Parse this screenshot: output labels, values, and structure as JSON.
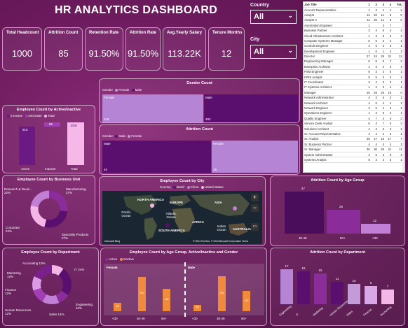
{
  "title": "HR ANALYTICS DASHBOARD",
  "kpis": [
    {
      "label": "Total Headcount",
      "value": "1000"
    },
    {
      "label": "Attrition Count",
      "value": "85"
    },
    {
      "label": "Retention Rate",
      "value": "91.50%"
    },
    {
      "label": "Attrition Rate",
      "value": "91.50%"
    },
    {
      "label": "Avg.Yearly Salary",
      "value": "113.22K"
    },
    {
      "label": "Tenure Months",
      "value": "12"
    }
  ],
  "slicers": {
    "country": {
      "label": "Country",
      "value": "All"
    },
    "city": {
      "label": "City",
      "value": "All"
    }
  },
  "job_table": {
    "header": [
      "Job Title",
      "1",
      "2",
      "3",
      "4",
      "Total"
    ],
    "rows": [
      [
        "Account Representative",
        "1",
        "3",
        "4",
        "4",
        "21"
      ],
      [
        "Analyst",
        "12",
        "20",
        "11",
        "8",
        "51"
      ],
      [
        "Analyst II",
        "11",
        "20",
        "11",
        "8",
        "52"
      ],
      [
        "Automation Engineer",
        "1",
        "",
        "3",
        "7",
        "7"
      ],
      [
        "Business Partner",
        "3",
        "4",
        "6",
        "4",
        "16"
      ],
      [
        "Cloud Infrastructure Architect",
        "1",
        "3",
        "5",
        "6",
        "17"
      ],
      [
        "Computer Systems Manager",
        "6",
        "5",
        "3",
        "3",
        "14"
      ],
      [
        "Controls Engineer",
        "4",
        "5",
        "2",
        "5",
        "16"
      ],
      [
        "Development Engineer",
        "1",
        "6",
        "1",
        "4",
        "12"
      ],
      [
        "Director",
        "27",
        "24",
        "29",
        "31",
        "121"
      ],
      [
        "Engineering Manager",
        "6",
        "5",
        "5",
        "7",
        "24"
      ],
      [
        "Enterprise Architect",
        "1",
        "3",
        "4",
        "3",
        "11"
      ],
      [
        "Field Engineer",
        "6",
        "3",
        "4",
        "5",
        "18"
      ],
      [
        "HRIS Analyst",
        "5",
        "5",
        "3",
        "3",
        "16"
      ],
      [
        "IT Coordinator",
        "3",
        "4",
        "3",
        "3",
        "11"
      ],
      [
        "IT Systems Architect",
        "1",
        "2",
        "3",
        "4",
        "10"
      ],
      [
        "Manager",
        "26",
        "28",
        "25",
        "19",
        "98"
      ],
      [
        "Network Administrator",
        "4",
        "3",
        "5",
        "3",
        "15"
      ],
      [
        "Network Architect",
        "4",
        "6",
        "4",
        "4",
        "18"
      ],
      [
        "Network Engineer",
        "3",
        "5",
        "4",
        "3",
        "15"
      ],
      [
        "Operations Engineer",
        "1",
        "3",
        "5",
        "2",
        "11"
      ],
      [
        "Quality Engineer",
        "4",
        "7",
        "4",
        "5",
        "20"
      ],
      [
        "Service Desk Analyst",
        "6",
        "4",
        "7",
        "6",
        "23"
      ],
      [
        "Solutions Architect",
        "4",
        "3",
        "6",
        "3",
        "15"
      ],
      [
        "Sr. Account Representative",
        "4",
        "4",
        "4",
        "3",
        "15"
      ],
      [
        "Sr. Analyst",
        "20",
        "17",
        "16",
        "17",
        "70"
      ],
      [
        "Sr. Business Partner",
        "4",
        "4",
        "4",
        "4",
        "16"
      ],
      [
        "Sr. Manager",
        "30",
        "30",
        "29",
        "31",
        "119"
      ],
      [
        "System Administrator",
        "4",
        "5",
        "3",
        "5",
        "17"
      ],
      [
        "Systems Analyst",
        "5",
        "3",
        "4",
        "5",
        "17"
      ]
    ]
  },
  "gender_count": {
    "title": "Gender Count",
    "legend_label": "Gender",
    "female_label": "Female",
    "female_value": "518",
    "male_label": "Male",
    "male_value": "482"
  },
  "attrition_count": {
    "title": "Attrition Count",
    "legend_label": "Gender",
    "male_label": "Male",
    "male_value": "46",
    "female_label": "Female",
    "female_value": "39"
  },
  "active_inactive": {
    "title": "Employee Count by Active/Inactive",
    "legend": [
      "Increase",
      "Decrease",
      "Total"
    ],
    "bars": [
      {
        "label": "Active",
        "value": "915"
      },
      {
        "label": "Inactive",
        "value": "85"
      },
      {
        "label": "Total",
        "value": "1000"
      }
    ]
  },
  "business_unit": {
    "title": "Employee Count by Business Unit",
    "labels": [
      {
        "name": "Research & Devel...",
        "pct": "22%"
      },
      {
        "name": "Manufacturing",
        "pct": "27%"
      },
      {
        "name": "Corporate",
        "pct": "24%"
      },
      {
        "name": "Speciality Products",
        "pct": "27%"
      }
    ]
  },
  "city_map": {
    "title": "Employee Count by City",
    "legend_label": "Country",
    "countries": [
      "Brazil",
      "China",
      "United States"
    ],
    "regions": [
      "NORTH AMERICA",
      "EUROPE",
      "ASIA",
      "AFRICA",
      "SOUTH AMERICA",
      "AUSTRALIA"
    ],
    "oceans": [
      "Pacific Ocean",
      "Atlantic Ocean",
      "Indian Ocean"
    ],
    "attribution": "Microsoft Bing",
    "copyright": "© 2024 TomTom, © 2024 Microsoft Corporation  Terms"
  },
  "age_group": {
    "title": "Attrition Count by Age Group",
    "bars": [
      {
        "label": "30-49",
        "value": "47"
      },
      {
        "label": "50+",
        "value": "26"
      },
      {
        "label": "<30",
        "value": "12"
      }
    ]
  },
  "department_donut": {
    "title": "Employee Count by Department",
    "labels": [
      {
        "name": "Accounting",
        "pct": "10%"
      },
      {
        "name": "IT",
        "pct": "24%"
      },
      {
        "name": "Marketing",
        "pct": "12%"
      },
      {
        "name": "Finance",
        "pct": "12%"
      },
      {
        "name": "Engineering",
        "pct": "10%"
      },
      {
        "name": "Human Resources",
        "pct": "12%"
      },
      {
        "name": "Sales",
        "pct": "14%"
      }
    ]
  },
  "age_active_gender": {
    "title": "Employee Count by Age Group, Active/Inactive and Gender",
    "legend": [
      "Active",
      "Inactive"
    ],
    "female_label": "Female",
    "male_label": "Male",
    "groups": [
      {
        "label": "<30",
        "value": "63"
      },
      {
        "label": "30-49",
        "value": "260"
      },
      {
        "label": "50+",
        "value": "166"
      },
      {
        "label": "<30",
        "value": "48"
      },
      {
        "label": "30-49",
        "value": "263"
      },
      {
        "label": "50+",
        "value": "152"
      }
    ]
  },
  "dept_attrition": {
    "title": "Attrition Count by Department",
    "bars": [
      {
        "label": "Engineering",
        "value": "17"
      },
      {
        "label": "IT",
        "value": "16"
      },
      {
        "label": "Marketing",
        "value": "15"
      },
      {
        "label": "Human Resources",
        "value": "11"
      },
      {
        "label": "Sales",
        "value": "10"
      },
      {
        "label": "Finance",
        "value": "9"
      },
      {
        "label": "Accounting",
        "value": "7"
      }
    ]
  },
  "colors": {
    "dark_purple": "#5a0f6e",
    "mid_purple": "#8a2d9a",
    "light_pink": "#f3b6e6",
    "orange": "#f08a3c"
  }
}
